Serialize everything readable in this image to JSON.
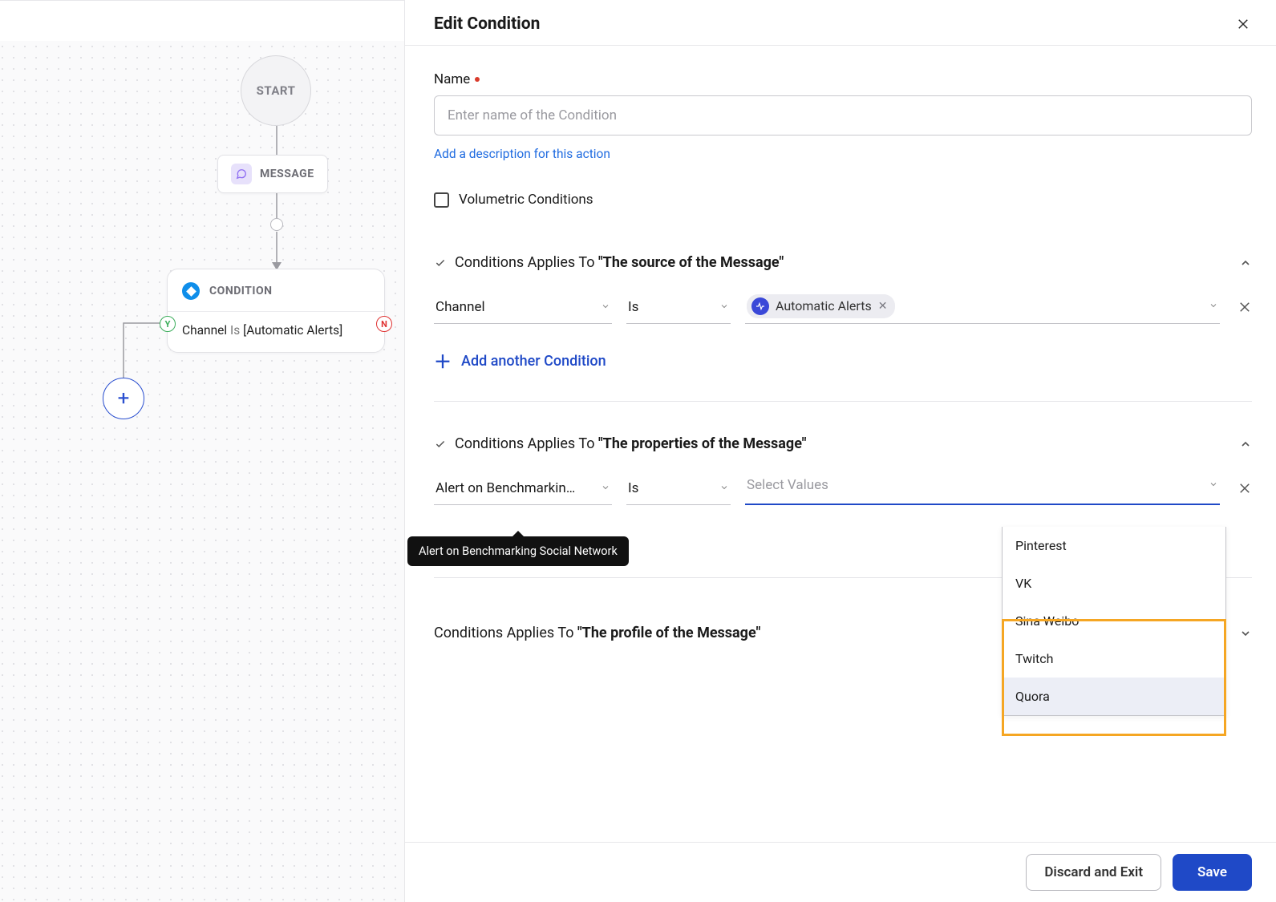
{
  "panel": {
    "title": "Edit Condition",
    "name_label": "Name",
    "name_placeholder": "Enter name of the Condition",
    "add_description_link": "Add a description for this action",
    "volumetric_label": "Volumetric Conditions",
    "add_condition_label": "Add another Condition",
    "discard_label": "Discard and Exit",
    "save_label": "Save"
  },
  "sections": {
    "s1_prefix": "Conditions Applies To ",
    "s1_bold": "\"The source of the Message\"",
    "s1_field": "Channel",
    "s1_op": "Is",
    "s1_value_chip": "Automatic Alerts",
    "s2_prefix": "Conditions Applies To ",
    "s2_bold": "\"The properties of the Message\"",
    "s2_field": "Alert on Benchmarking ...",
    "s2_field_full": "Alert on Benchmarking Social Network",
    "s2_op": "Is",
    "s2_value_placeholder": "Select Values",
    "s3_prefix": "Conditions Applies To ",
    "s3_bold": "\"The profile of the Message\""
  },
  "dropdown": {
    "items": [
      "Pinterest",
      "VK",
      "Sina Weibo",
      "Twitch",
      "Quora"
    ]
  },
  "canvas": {
    "start": "START",
    "message": "MESSAGE",
    "condition": "CONDITION",
    "cond_field": "Channel ",
    "cond_op": "Is ",
    "cond_value": "[Automatic Alerts]",
    "yes_badge": "Y",
    "no_badge": "N"
  },
  "tooltip": "Alert on Benchmarking Social Network"
}
